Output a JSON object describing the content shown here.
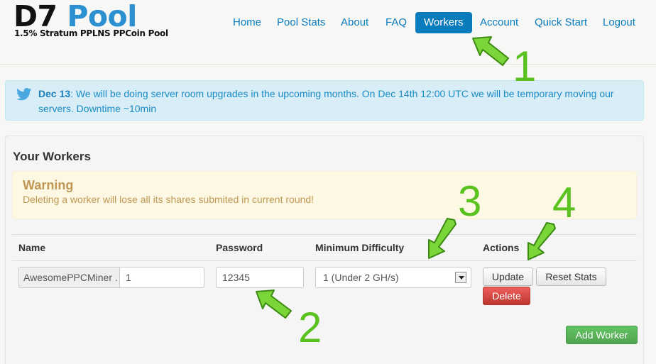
{
  "brand": {
    "name_part1": "D7",
    "name_part2": "Pool",
    "tagline": "1.5% Stratum PPLNS PPCoin Pool",
    "accent_color": "#2b8fd0"
  },
  "nav": {
    "items": [
      {
        "label": "Home"
      },
      {
        "label": "Pool Stats"
      },
      {
        "label": "About"
      },
      {
        "label": "FAQ"
      },
      {
        "label": "Workers",
        "active": true
      },
      {
        "label": "Account"
      },
      {
        "label": "Quick Start"
      },
      {
        "label": "Logout"
      }
    ]
  },
  "announcement": {
    "icon": "twitter-icon",
    "date": "Dec 13",
    "text": ": We will be doing server room upgrades in the upcoming months. On Dec 14th 12:00 UTC we will be temporary moving our servers. Downtime ~10min"
  },
  "workers": {
    "title": "Your Workers",
    "warning": {
      "title": "Warning",
      "text": "Deleting a worker will lose all its shares submited in current round!"
    },
    "columns": {
      "name": "Name",
      "password": "Password",
      "difficulty": "Minimum Difficulty",
      "actions": "Actions"
    },
    "rows": [
      {
        "name_prefix": "AwesomePPCMiner .",
        "name_suffix": "1",
        "password": "12345",
        "difficulty": "1 (Under 2 GH/s)"
      }
    ],
    "buttons": {
      "update": "Update",
      "reset_stats": "Reset Stats",
      "delete": "Delete",
      "add_worker": "Add Worker"
    }
  },
  "annotations": {
    "color": "#5ac21e",
    "labels": [
      "1",
      "2",
      "3",
      "4"
    ]
  }
}
